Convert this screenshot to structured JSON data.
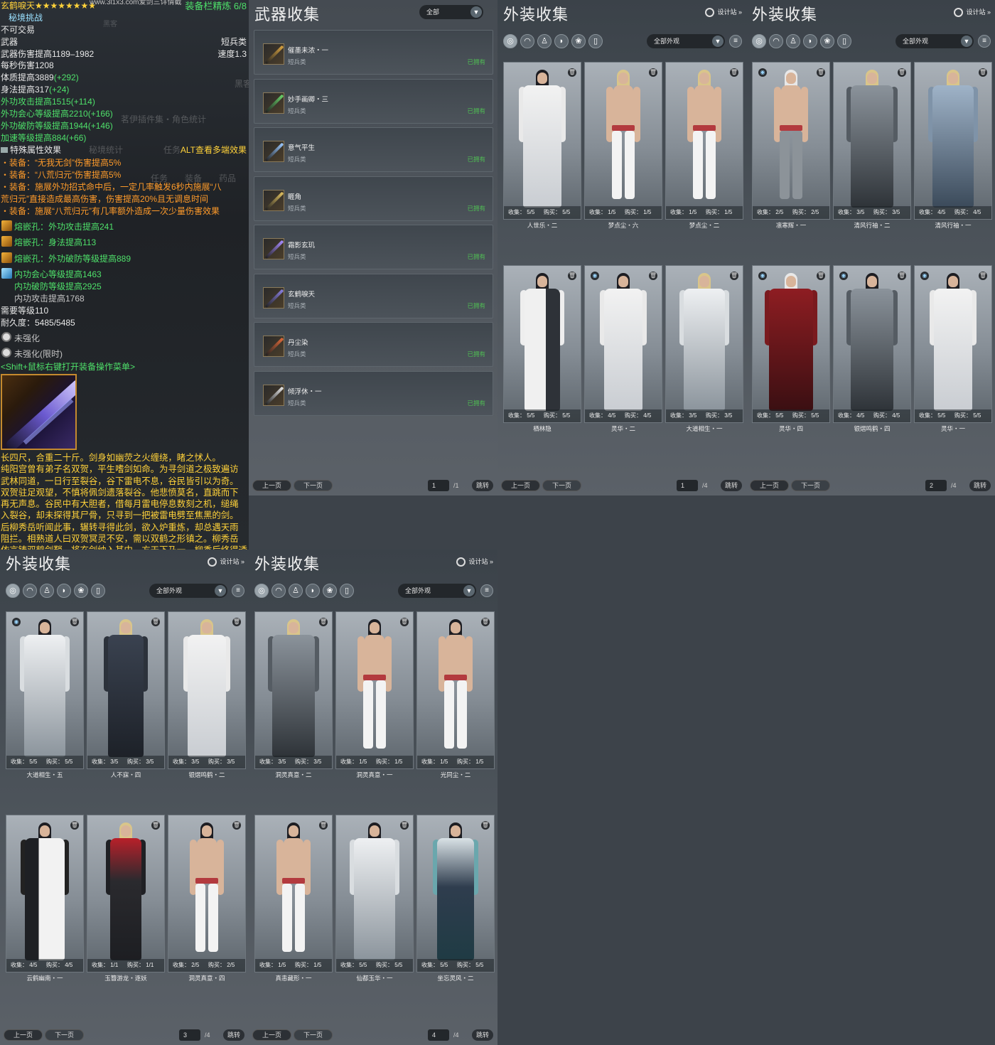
{
  "tooltip": {
    "title": "玄鹤唳天★★★★★★★★",
    "watermark_url": "www.3l1x3.com爱剑三详情截",
    "refine_label": "装备栏精炼 6/8",
    "tag": "秘境挑战",
    "no_trade": "不可交易",
    "slot": "武器",
    "weapon_type": "短兵类",
    "damage": "武器伤害提高1189–1982",
    "speed": "速度1.3",
    "dps": "每秒伤害1208",
    "attr1_base": "体质提高3889",
    "attr1_bonus": "(+292)",
    "attr2_base": "身法提高317",
    "attr2_bonus": "(+24)",
    "attr3_base": "外功攻击提高1515",
    "attr3_bonus": "(+114)",
    "attr4_base": "外功会心等级提高2210",
    "attr4_bonus": "(+166)",
    "attr5_base": "外功破防等级提高1944",
    "attr5_bonus": "(+146)",
    "attr6_base": "加速等级提高884",
    "attr6_bonus": "(+66)",
    "special_label": "特殊属性效果",
    "alt_hint": "ALT查看多端效果",
    "effect1": "・装备：“无我无剑”伤害提高5%",
    "effect2": "・装备：“八荒归元”伤害提高5%",
    "effect3a": "・装备：施展外功招式命中后，一定几率触发6秒内施展“八",
    "effect3b": "荒归元”直接造成最高伤害，伤害提高20%且无调息时间",
    "effect4": "・装备：施展“八荒归元”有几率额外造成一次少量伤害效果",
    "socket1": "熔嵌孔：外功攻击提高241",
    "socket2": "熔嵌孔：身法提高113",
    "socket3": "熔嵌孔：外功破防等级提高889",
    "socket4": "内功会心等级提高1463",
    "socket5": "内功破防等级提高2925",
    "socket6": "内功攻击提高1768",
    "level_req": "需要等级110",
    "durability": "耐久度：5485/5485",
    "strengthen1": "未强化",
    "strengthen2": "未强化(限时)",
    "shift_hint": "<Shift+鼠标右键打开装备操作菜单>",
    "bg_texts": [
      "黑客",
      "茗伊插件集・角色统计",
      "秘境统计",
      "任务",
      "装备",
      "药品"
    ],
    "lore": [
      "长四尺，合重二十斤。剑身如幽荧之火缠绕，睹之怵人。",
      "纯阳宫曾有弟子名双贺，平生嗜剑如命。为寻剑道之极致遍访",
      "武林同道，一日行至裂谷，谷下雷电不息，谷民皆引以为奇。",
      "双贺驻足观望，不慎将佩剑遗落裂谷。他悲愤莫名，直跳而下",
      "再无声息。谷民中有大胆者，借每月雷电停息数刻之机，缒绳",
      "入裂谷，却未探得其尸骨，只寻到一把被雷电劈至焦黑的剑。",
      "后柳秀岳听闻此事，辗转寻得此剑，欲入炉重炼，却总遇天雨",
      "阻拦。相熟道人曰双贺冥灵不安，需以双鹤之形镇之。柳秀岳",
      "依言铸双鹤剑鞘，将玄剑纳入其中，方天下乃一，柳秀后终得透"
    ]
  },
  "weapons": {
    "title": "武器收集",
    "filter": "全部",
    "items": [
      {
        "name": "催墨未浓・一",
        "cat": "短兵类",
        "owned": "已拥有",
        "color": "#d9a441"
      },
      {
        "name": "妙手画卿・三",
        "cat": "短兵类",
        "owned": "已拥有",
        "color": "#6ad36a"
      },
      {
        "name": "意气平生",
        "cat": "短兵类",
        "owned": "已拥有",
        "color": "#9ac8ff"
      },
      {
        "name": "睚角",
        "cat": "短兵类",
        "owned": "已拥有",
        "color": "#e0c060"
      },
      {
        "name": "霜影玄玑",
        "cat": "短兵类",
        "owned": "已拥有",
        "color": "#a88cff"
      },
      {
        "name": "玄鹤唳天",
        "cat": "短兵类",
        "owned": "已拥有",
        "color": "#8a80e0"
      },
      {
        "name": "丹尘染",
        "cat": "短兵类",
        "owned": "已拥有",
        "color": "#e06a3a"
      },
      {
        "name": "倾浮休・一",
        "cat": "短兵类",
        "owned": "已拥有",
        "color": "#e8e8e8"
      }
    ],
    "pager": {
      "prev": "上一页",
      "next": "下一页",
      "page": "1",
      "total": "/1",
      "jump": "跳转"
    }
  },
  "outfit_common": {
    "title": "外装收集",
    "designer": "设计站",
    "filter": "全部外观",
    "stat_collect": "收集：",
    "stat_buy": "购买：",
    "prev": "上一页",
    "next": "下一页",
    "jump": "跳转",
    "total": "/4"
  },
  "outfit_pages": [
    {
      "page": "1",
      "cards": [
        {
          "name": "人世乐・二",
          "c": "5/5",
          "b": "5/5",
          "style": "white",
          "hair": "#1d1d22",
          "dye": false
        },
        {
          "name": "梦点尘・六",
          "c": "1/5",
          "b": "1/5",
          "style": "bare",
          "hair": "#d9c58a",
          "dye": false
        },
        {
          "name": "梦点尘・二",
          "c": "1/5",
          "b": "1/5",
          "style": "bare",
          "hair": "#d9c58a",
          "dye": false
        },
        {
          "name": "栖林隐",
          "c": "5/5",
          "b": "5/5",
          "style": "whitedark",
          "hair": "#1d1d22",
          "dye": false
        },
        {
          "name": "灵华・二",
          "c": "4/5",
          "b": "4/5",
          "style": "white",
          "hair": "#1d1d22",
          "dye": true
        },
        {
          "name": "大道相生・一",
          "c": "3/5",
          "b": "3/5",
          "style": "whitegray",
          "hair": "#d9c58a",
          "dye": false
        }
      ]
    },
    {
      "page": "2",
      "cards": [
        {
          "name": "凛寒辉・一",
          "c": "2/5",
          "b": "2/5",
          "style": "barepants",
          "hair": "#e8e8e8",
          "dye": true
        },
        {
          "name": "清风行袖・二",
          "c": "3/5",
          "b": "3/5",
          "style": "graydark",
          "hair": "#d9c58a",
          "dye": false
        },
        {
          "name": "清风行袖・一",
          "c": "4/5",
          "b": "4/5",
          "style": "bluedark",
          "hair": "#d9c58a",
          "dye": false
        },
        {
          "name": "灵华・四",
          "c": "5/5",
          "b": "5/5",
          "style": "red",
          "hair": "#e8e8e8",
          "dye": true
        },
        {
          "name": "银熠鸣鹤・四",
          "c": "4/5",
          "b": "4/5",
          "style": "graydark",
          "hair": "#1d1d22",
          "dye": true
        },
        {
          "name": "灵华・一",
          "c": "5/5",
          "b": "5/5",
          "style": "white",
          "hair": "#1d1d22",
          "dye": true
        }
      ]
    },
    {
      "page": "3",
      "cards": [
        {
          "name": "大道相生・五",
          "c": "5/5",
          "b": "5/5",
          "style": "whitegray",
          "hair": "#1d1d22",
          "dye": true
        },
        {
          "name": "人不寐・四",
          "c": "3/5",
          "b": "3/5",
          "style": "navy",
          "hair": "#d9c58a",
          "dye": false
        },
        {
          "name": "银熠鸣鹤・二",
          "c": "3/5",
          "b": "3/5",
          "style": "white",
          "hair": "#d9c58a",
          "dye": false
        },
        {
          "name": "云鹤幽南・一",
          "c": "4/5",
          "b": "4/5",
          "style": "blackwhite",
          "hair": "#1d1d22",
          "dye": false
        },
        {
          "name": "玉簪游龙・逐妖",
          "c": "1/1",
          "b": "1/1",
          "style": "blackred",
          "hair": "#d9c58a",
          "dye": false
        },
        {
          "name": "洞灵真意・四",
          "c": "2/5",
          "b": "2/5",
          "style": "bare",
          "hair": "#1d1d22",
          "dye": false
        }
      ]
    },
    {
      "page": "4",
      "cards": [
        {
          "name": "洞灵真意・二",
          "c": "3/5",
          "b": "3/5",
          "style": "graydark",
          "hair": "#d9c58a",
          "dye": false
        },
        {
          "name": "洞灵真意・一",
          "c": "1/5",
          "b": "1/5",
          "style": "bare",
          "hair": "#1d1d22",
          "dye": false
        },
        {
          "name": "光同尘・二",
          "c": "1/5",
          "b": "1/5",
          "style": "bare",
          "hair": "#1d1d22",
          "dye": false
        },
        {
          "name": "真恚藏形・一",
          "c": "1/5",
          "b": "1/5",
          "style": "bare",
          "hair": "#1d1d22",
          "dye": false
        },
        {
          "name": "仙都玉华・一",
          "c": "5/5",
          "b": "5/5",
          "style": "whitegray",
          "hair": "#1d1d22",
          "dye": false
        },
        {
          "name": "坐忘灵风・二",
          "c": "5/5",
          "b": "5/5",
          "style": "teal",
          "hair": "#1d1d22",
          "dye": false
        }
      ]
    }
  ]
}
